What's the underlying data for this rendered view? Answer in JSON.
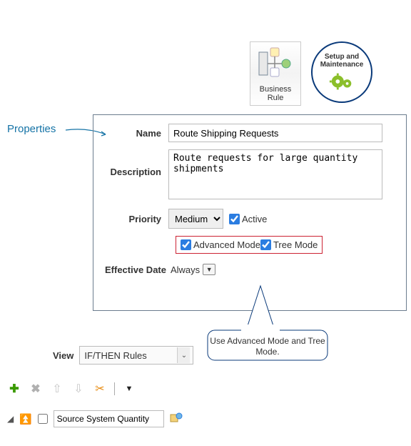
{
  "topIcons": {
    "businessRule": "Business Rule",
    "setup": "Setup and Maintenance"
  },
  "calloutLabel": "Properties",
  "form": {
    "nameLabel": "Name",
    "nameValue": "Route Shipping Requests",
    "descLabel": "Description",
    "descValue": "Route requests for large quantity shipments",
    "priorityLabel": "Priority",
    "priorityValue": "Medium",
    "activeLabel": "Active",
    "advModeLabel": "Advanced Mode",
    "treeModeLabel": "Tree Mode",
    "effDateLabel": "Effective Date",
    "effDateValue": "Always"
  },
  "bubble": "Use Advanced Mode and Tree Mode.",
  "view": {
    "label": "View",
    "value": "IF/THEN Rules"
  },
  "bottom": {
    "sourceValue": "Source System Quantity"
  }
}
